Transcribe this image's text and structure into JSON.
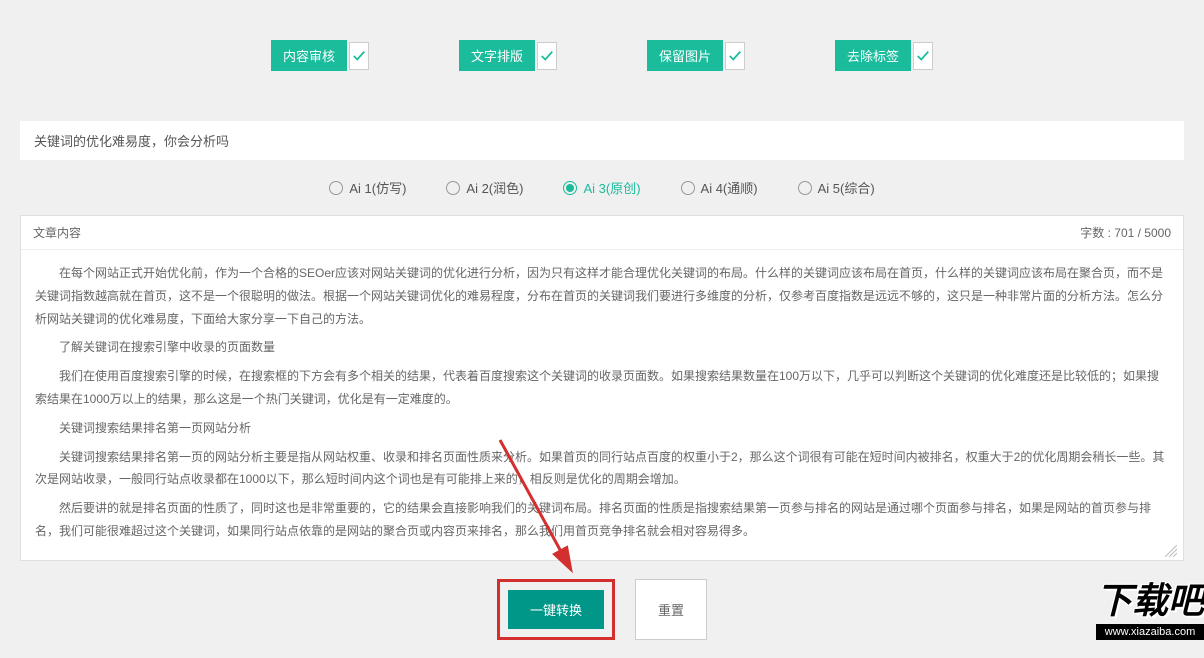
{
  "options": [
    {
      "label": "内容审核"
    },
    {
      "label": "文字排版"
    },
    {
      "label": "保留图片"
    },
    {
      "label": "去除标签"
    }
  ],
  "title": "关键词的优化难易度，你会分析吗",
  "tabs": [
    {
      "label": "Ai 1(仿写)",
      "selected": false
    },
    {
      "label": "Ai 2(润色)",
      "selected": false
    },
    {
      "label": "Ai 3(原创)",
      "selected": true
    },
    {
      "label": "Ai 4(通顺)",
      "selected": false
    },
    {
      "label": "Ai 5(综合)",
      "selected": false
    }
  ],
  "content": {
    "header_label": "文章内容",
    "word_count": "字数 : 701 / 5000",
    "paragraphs": [
      "在每个网站正式开始优化前，作为一个合格的SEOer应该对网站关键词的优化进行分析，因为只有这样才能合理优化关键词的布局。什么样的关键词应该布局在首页，什么样的关键词应该布局在聚合页，而不是关键词指数越高就在首页，这不是一个很聪明的做法。根据一个网站关键词优化的难易程度，分布在首页的关键词我们要进行多维度的分析，仅参考百度指数是远远不够的，这只是一种非常片面的分析方法。怎么分析网站关键词的优化难易度，下面给大家分享一下自己的方法。",
      "了解关键词在搜索引擎中收录的页面数量",
      "我们在使用百度搜索引擎的时候，在搜索框的下方会有多个相关的结果，代表着百度搜索这个关键词的收录页面数。如果搜索结果数量在100万以下，几乎可以判断这个关键词的优化难度还是比较低的；如果搜索结果在1000万以上的结果，那么这是一个热门关键词，优化是有一定难度的。",
      "关键词搜索结果排名第一页网站分析",
      "关键词搜索结果排名第一页的网站分析主要是指从网站权重、收录和排名页面性质来分析。如果首页的同行站点百度的权重小于2，那么这个词很有可能在短时间内被排名，权重大于2的优化周期会稍长一些。其次是网站收录，一般同行站点收录都在1000以下，那么短时间内这个词也是有可能排上来的，相反则是优化的周期会增加。",
      "然后要讲的就是排名页面的性质了，同时这也是非常重要的，它的结果会直接影响我们的关键词布局。排名页面的性质是指搜索结果第一页参与排名的网站是通过哪个页面参与排名，如果是网站的首页参与排名，我们可能很难超过这个关键词，如果同行站点依靠的是网站的聚合页或内容页来排名，那么我们用首页竞争排名就会相对容易得多。"
    ]
  },
  "buttons": {
    "convert": "一键转换",
    "reset": "重置"
  },
  "watermark": {
    "main": "下载吧",
    "url": "www.xiazaiba.com"
  }
}
